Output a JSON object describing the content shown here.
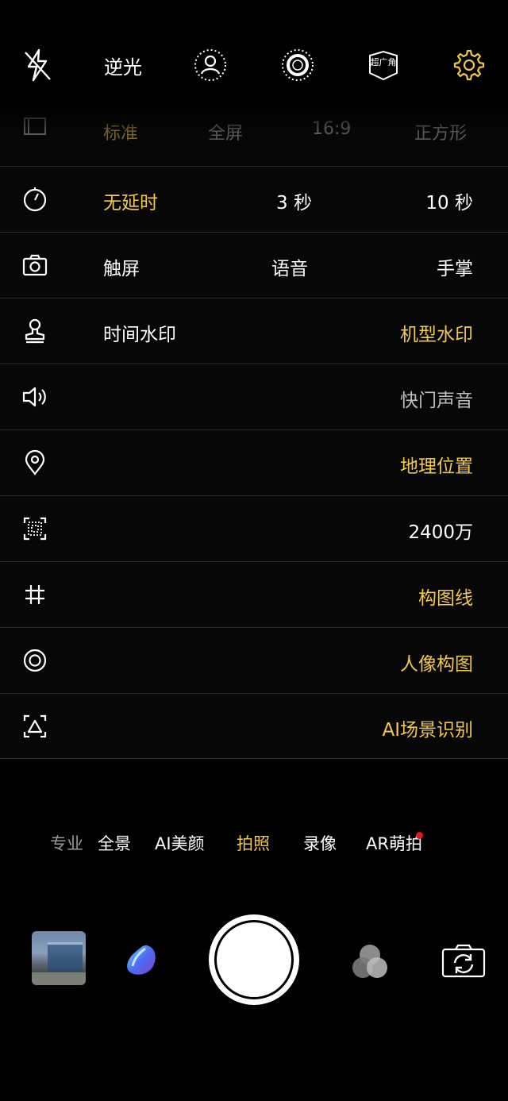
{
  "topbar": {
    "flash_icon": "flash-off-icon",
    "backlight_label": "逆光",
    "portrait_icon": "portrait-mode-icon",
    "live_icon": "live-photo-icon",
    "wide_label": "超广角",
    "settings_icon": "gear-icon"
  },
  "ratio": {
    "icon": "aspect-ratio-icon",
    "options": [
      "标准",
      "全屏",
      "16:9",
      "正方形"
    ],
    "selected": "标准"
  },
  "timer": {
    "icon": "timer-icon",
    "options": [
      "无延时",
      "3 秒",
      "10 秒"
    ],
    "selected": "无延时"
  },
  "capture_mode": {
    "icon": "camera-icon",
    "options": [
      "触屏",
      "语音",
      "手掌"
    ]
  },
  "watermark": {
    "icon": "stamp-icon",
    "options": [
      "时间水印",
      "机型水印"
    ],
    "selected": "机型水印"
  },
  "shutter_sound": {
    "icon": "speaker-icon",
    "label": "快门声音",
    "enabled": false
  },
  "location": {
    "icon": "location-pin-icon",
    "label": "地理位置",
    "enabled": true
  },
  "resolution": {
    "icon": "resolution-grid-icon",
    "label": "2400万"
  },
  "grid_lines": {
    "icon": "grid-icon",
    "label": "构图线",
    "enabled": true
  },
  "portrait_composition": {
    "icon": "target-circle-icon",
    "label": "人像构图",
    "enabled": true
  },
  "ai_scene": {
    "icon": "scene-frame-icon",
    "label": "AI场景识别",
    "enabled": true
  },
  "modes": {
    "items": [
      "专业",
      "全景",
      "AI美颜",
      "拍照",
      "录像",
      "AR萌拍"
    ],
    "selected": "拍照",
    "ar_badge_color": "#e01818"
  },
  "bottom": {
    "gallery_icon": "gallery-thumbnail",
    "beauty_icon": "beauty-filter-icon",
    "shutter_icon": "shutter-button",
    "filters_icon": "filters-icon",
    "flip_icon": "flip-camera-icon"
  },
  "colors": {
    "accent": "#f2c84b",
    "background": "#000000",
    "divider": "#2a2a2a"
  }
}
